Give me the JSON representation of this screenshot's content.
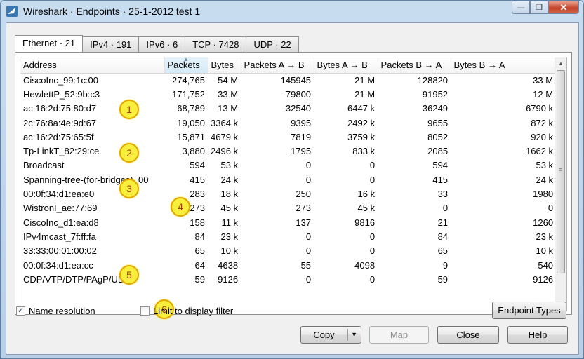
{
  "window": {
    "title": "Wireshark · Endpoints · 25-1-2012 test 1",
    "minimize_glyph": "—",
    "restore_glyph": "❐",
    "close_glyph": "✕"
  },
  "tabs": [
    {
      "label": "Ethernet · 21",
      "active": true
    },
    {
      "label": "IPv4 · 191",
      "active": false
    },
    {
      "label": "IPv6 · 6",
      "active": false
    },
    {
      "label": "TCP · 7428",
      "active": false
    },
    {
      "label": "UDP · 22",
      "active": false
    }
  ],
  "table": {
    "columns": [
      "Address",
      "Packets",
      "Bytes",
      "Packets A → B",
      "Bytes A → B",
      "Packets B → A",
      "Bytes B → A"
    ],
    "sorted_column": "Packets",
    "rows": [
      [
        "CiscoInc_99:1c:00",
        "274,765",
        "54 M",
        "145945",
        "21 M",
        "128820",
        "33 M"
      ],
      [
        "HewlettP_52:9b:c3",
        "171,752",
        "33 M",
        "79800",
        "21 M",
        "91952",
        "12 M"
      ],
      [
        "ac:16:2d:75:80:d7",
        "68,789",
        "13 M",
        "32540",
        "6447 k",
        "36249",
        "6790 k"
      ],
      [
        "2c:76:8a:4e:9d:67",
        "19,050",
        "3364 k",
        "9395",
        "2492 k",
        "9655",
        "872 k"
      ],
      [
        "ac:16:2d:75:65:5f",
        "15,871",
        "4679 k",
        "7819",
        "3759 k",
        "8052",
        "920 k"
      ],
      [
        "Tp-LinkT_82:29:ce",
        "3,880",
        "2496 k",
        "1795",
        "833 k",
        "2085",
        "1662 k"
      ],
      [
        "Broadcast",
        "594",
        "53 k",
        "0",
        "0",
        "594",
        "53 k"
      ],
      [
        "Spanning-tree-(for-bridges)_00",
        "415",
        "24 k",
        "0",
        "0",
        "415",
        "24 k"
      ],
      [
        "00:0f:34:d1:ea:e0",
        "283",
        "18 k",
        "250",
        "16 k",
        "33",
        "1980"
      ],
      [
        "WistronI_ae:77:69",
        "273",
        "45 k",
        "273",
        "45 k",
        "0",
        "0"
      ],
      [
        "CiscoInc_d1:ea:d8",
        "158",
        "11 k",
        "137",
        "9816",
        "21",
        "1260"
      ],
      [
        "IPv4mcast_7f:ff:fa",
        "84",
        "23 k",
        "0",
        "0",
        "84",
        "23 k"
      ],
      [
        "33:33:00:01:00:02",
        "65",
        "10 k",
        "0",
        "0",
        "65",
        "10 k"
      ],
      [
        "00:0f:34:d1:ea:cc",
        "64",
        "4638",
        "55",
        "4098",
        "9",
        "540"
      ],
      [
        "CDP/VTP/DTP/PAgP/UDLD",
        "59",
        "9126",
        "0",
        "0",
        "59",
        "9126"
      ]
    ]
  },
  "markers": [
    "1",
    "2",
    "3",
    "4",
    "5",
    "6"
  ],
  "options": {
    "name_resolution": {
      "label": "Name resolution",
      "checked": true
    },
    "limit_filter": {
      "label": "Limit to display filter",
      "checked": false
    }
  },
  "buttons": {
    "endpoint_types": "Endpoint Types",
    "copy": "Copy",
    "map": "Map",
    "close": "Close",
    "help": "Help"
  },
  "icons": {
    "app": "wireshark-fin-icon",
    "check": "✓",
    "dropdown": "▼",
    "scroll_up": "▲",
    "scroll_down": "▼",
    "sort": "▲"
  }
}
